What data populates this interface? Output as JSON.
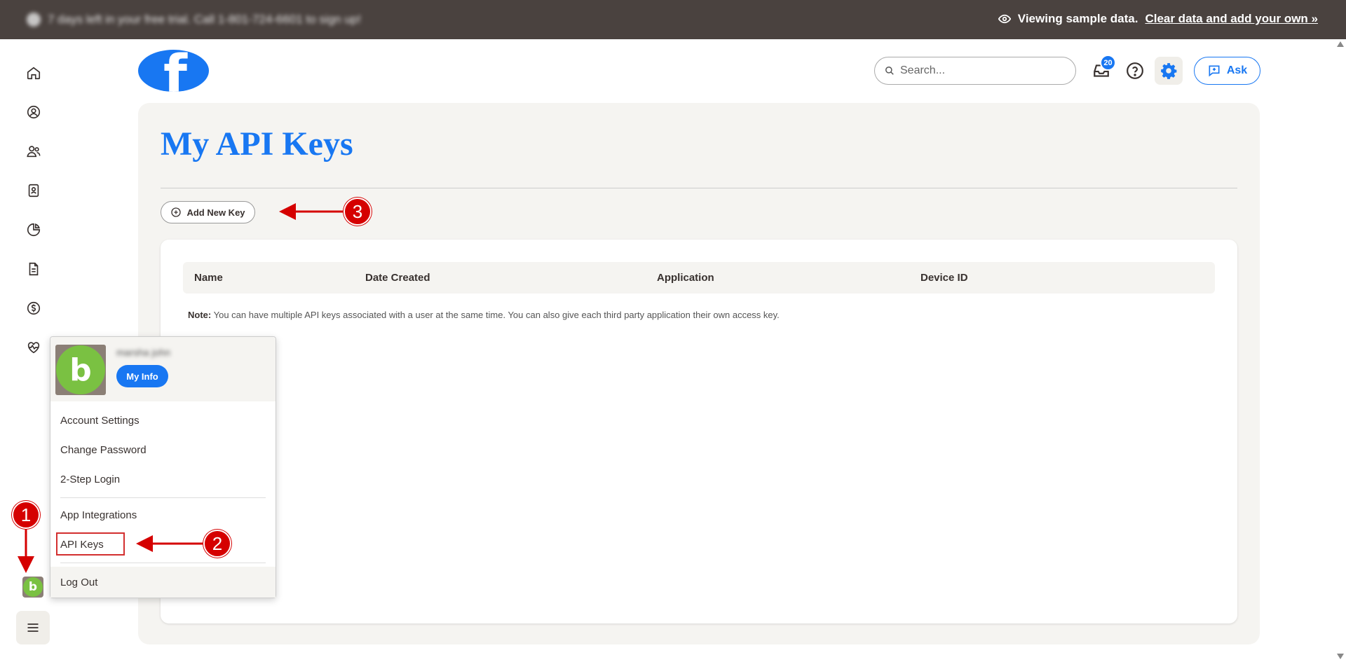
{
  "banner": {
    "trial_text": "7 days left in your free trial. Call 1-801-724-6601 to sign up!",
    "viewing_text": "Viewing sample data.",
    "clear_link": "Clear data and add your own »"
  },
  "leftnav": {
    "icons": [
      "home-icon",
      "user-circle-icon",
      "people-icon",
      "badge-icon",
      "pie-chart-icon",
      "document-icon",
      "dollar-icon",
      "heart-pulse-icon"
    ]
  },
  "header": {
    "logo_glyph": "f",
    "search_placeholder": "Search...",
    "inbox_count": "20",
    "ask_label": "Ask"
  },
  "page": {
    "title": "My API Keys",
    "add_button": "Add New Key",
    "table": {
      "columns": [
        "Name",
        "Date Created",
        "Application",
        "Device ID"
      ]
    },
    "note_label": "Note:",
    "note_text": "You can have multiple API keys associated with a user at the same time. You can also give each third party application their own access key."
  },
  "user_menu": {
    "user_name": "marsha john",
    "avatar_glyph": "b",
    "my_info": "My Info",
    "items": [
      "Account Settings",
      "Change Password",
      "2-Step Login",
      "App Integrations",
      "API Keys"
    ],
    "logout": "Log Out"
  },
  "annotations": {
    "steps": [
      "1",
      "2",
      "3"
    ],
    "color": "#d50000"
  },
  "colors": {
    "accent": "#1877f2",
    "banner_bg": "#4a423f",
    "avatar_green": "#7ac142"
  }
}
